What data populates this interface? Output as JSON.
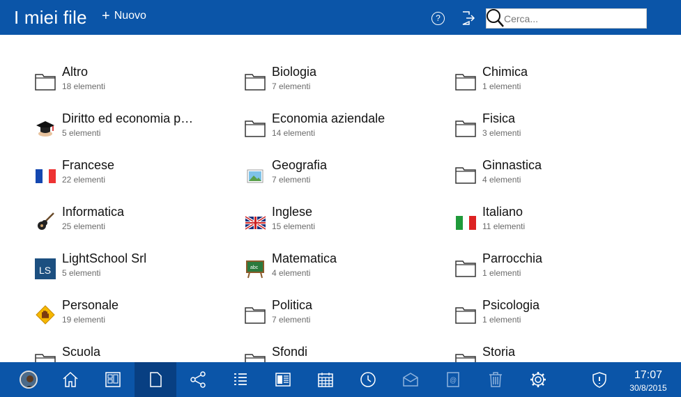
{
  "header": {
    "title": "I miei file",
    "new_label": "Nuovo",
    "search_placeholder": "Cerca...",
    "help_glyph": "?"
  },
  "folders": [
    {
      "name": "Altro",
      "count": "18 elementi",
      "icon": "folder-icon"
    },
    {
      "name": "Biologia",
      "count": "7 elementi",
      "icon": "folder-icon"
    },
    {
      "name": "Chimica",
      "count": "1 elementi",
      "icon": "folder-icon"
    },
    {
      "name": "Diritto ed economia p…",
      "count": "5 elementi",
      "icon": "graduation-cap-icon"
    },
    {
      "name": "Economia aziendale",
      "count": "14 elementi",
      "icon": "folder-icon"
    },
    {
      "name": "Fisica",
      "count": "3 elementi",
      "icon": "folder-icon"
    },
    {
      "name": "Francese",
      "count": "22 elementi",
      "icon": "french-flag-icon"
    },
    {
      "name": "Geografia",
      "count": "7 elementi",
      "icon": "picture-icon"
    },
    {
      "name": "Ginnastica",
      "count": "4 elementi",
      "icon": "folder-icon"
    },
    {
      "name": "Informatica",
      "count": "25 elementi",
      "icon": "guitar-icon"
    },
    {
      "name": "Inglese",
      "count": "15 elementi",
      "icon": "uk-flag-icon"
    },
    {
      "name": "Italiano",
      "count": "11 elementi",
      "icon": "italian-flag-icon"
    },
    {
      "name": "LightSchool Srl",
      "count": "5 elementi",
      "icon": "lightschool-logo-icon"
    },
    {
      "name": "Matematica",
      "count": "4 elementi",
      "icon": "chalkboard-icon"
    },
    {
      "name": "Parrocchia",
      "count": "1 elementi",
      "icon": "folder-icon"
    },
    {
      "name": "Personale",
      "count": "19 elementi",
      "icon": "stop-hand-sign-icon"
    },
    {
      "name": "Politica",
      "count": "7 elementi",
      "icon": "folder-icon"
    },
    {
      "name": "Psicologia",
      "count": "1 elementi",
      "icon": "folder-icon"
    },
    {
      "name": "Scuola",
      "count": "",
      "icon": "folder-icon"
    },
    {
      "name": "Sfondi",
      "count": "",
      "icon": "folder-icon"
    },
    {
      "name": "Storia",
      "count": "",
      "icon": "folder-icon"
    }
  ],
  "taskbar": {
    "items": [
      "avatar",
      "home-icon",
      "dashboard-icon",
      "file-icon",
      "share-icon",
      "list-icon",
      "reader-icon",
      "calendar-icon",
      "clock-icon",
      "mail-icon",
      "contacts-icon",
      "trash-icon",
      "gear-icon",
      "shield-icon"
    ],
    "active": "file-icon",
    "time": "17:07",
    "date": "30/8/2015"
  },
  "colors": {
    "bar": "#0b55a8",
    "active": "#083f82"
  }
}
